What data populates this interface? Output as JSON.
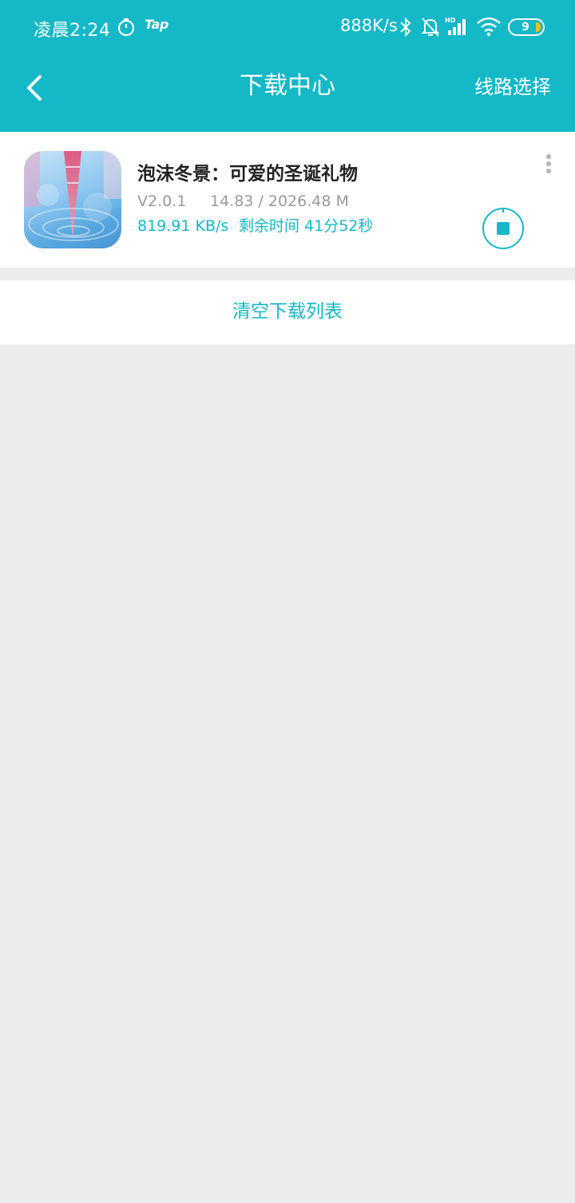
{
  "status_bar": {
    "time": "凌晨2:24",
    "tap_label": "Tap",
    "net_speed": "888K/s",
    "battery": "9",
    "icons": [
      "timer-icon",
      "bluetooth-icon",
      "mute-icon",
      "hd-signal-icon",
      "wifi-icon",
      "battery-icon"
    ]
  },
  "header": {
    "title": "下载中心",
    "route_select": "线路选择"
  },
  "download": {
    "name": "泡沫冬景：可爱的圣诞礼物",
    "version": "V2.0.1",
    "progress": "14.83 / 2026.48 M",
    "speed": "819.91 KB/s",
    "remaining": "剩余时间 41分52秒"
  },
  "actions": {
    "clear_list": "清空下载列表"
  },
  "colors": {
    "accent": "#14b8c6",
    "background": "#ececec"
  }
}
